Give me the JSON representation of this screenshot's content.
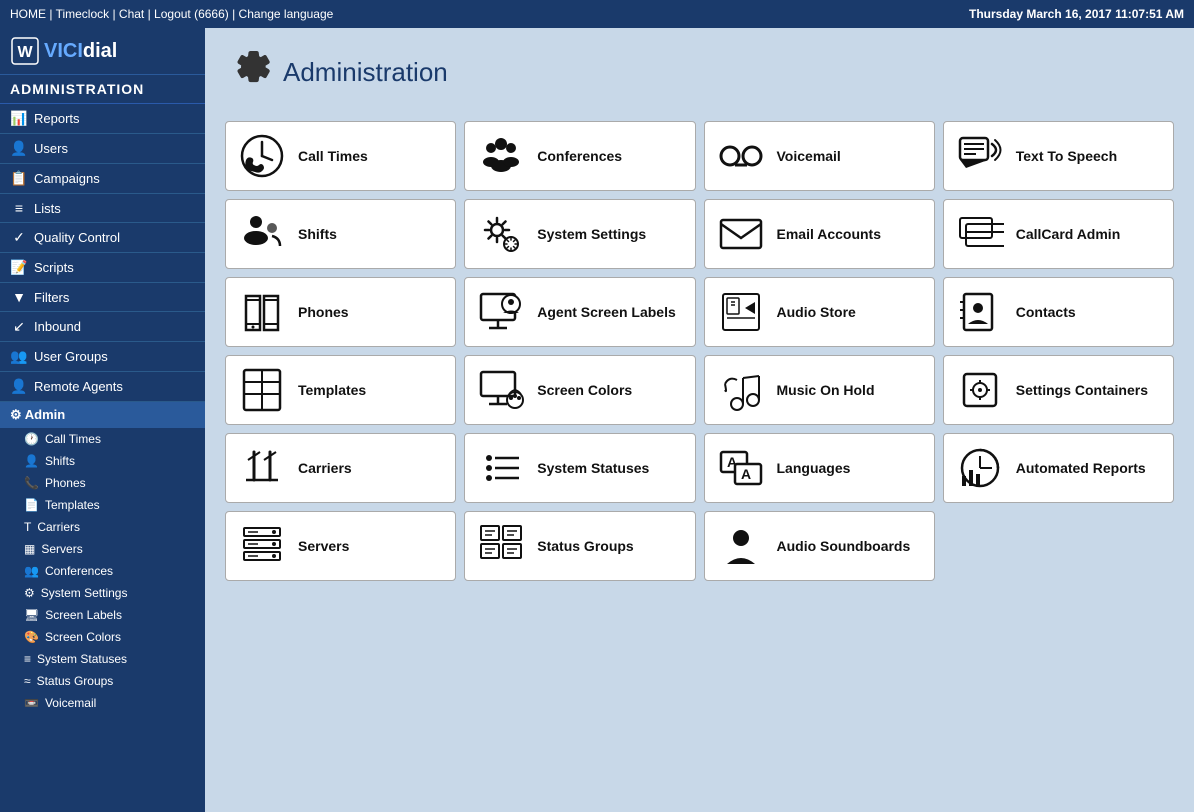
{
  "topbar": {
    "links": "HOME | Timeclock | Chat | Logout (6666) | Change language",
    "datetime": "Thursday March 16, 2017  11:07:51 AM"
  },
  "sidebar": {
    "logo": "VICIdial",
    "admin_title": "ADMINISTRATION",
    "nav_items": [
      {
        "label": "Reports",
        "icon": "📊",
        "name": "reports"
      },
      {
        "label": "Users",
        "icon": "👤",
        "name": "users"
      },
      {
        "label": "Campaigns",
        "icon": "📋",
        "name": "campaigns"
      },
      {
        "label": "Lists",
        "icon": "≡",
        "name": "lists"
      },
      {
        "label": "Quality Control",
        "icon": "✓",
        "name": "quality-control"
      },
      {
        "label": "Scripts",
        "icon": "📝",
        "name": "scripts"
      },
      {
        "label": "Filters",
        "icon": "▼",
        "name": "filters"
      },
      {
        "label": "Inbound",
        "icon": "↙",
        "name": "inbound"
      },
      {
        "label": "User Groups",
        "icon": "👥",
        "name": "user-groups"
      },
      {
        "label": "Remote Agents",
        "icon": "👤",
        "name": "remote-agents"
      }
    ],
    "admin_section": "Admin",
    "admin_subitems": [
      {
        "label": "Call Times",
        "icon": "🕐",
        "name": "call-times"
      },
      {
        "label": "Shifts",
        "icon": "👤",
        "name": "shifts"
      },
      {
        "label": "Phones",
        "icon": "📞",
        "name": "phones"
      },
      {
        "label": "Templates",
        "icon": "📄",
        "name": "templates"
      },
      {
        "label": "Carriers",
        "icon": "T",
        "name": "carriers"
      },
      {
        "label": "Servers",
        "icon": "▦",
        "name": "servers"
      },
      {
        "label": "Conferences",
        "icon": "👥",
        "name": "conferences"
      },
      {
        "label": "System Settings",
        "icon": "⚙",
        "name": "system-settings"
      },
      {
        "label": "Screen Labels",
        "icon": "🖥",
        "name": "screen-labels"
      },
      {
        "label": "Screen Colors",
        "icon": "🎨",
        "name": "screen-colors"
      },
      {
        "label": "System Statuses",
        "icon": "≡",
        "name": "system-statuses"
      },
      {
        "label": "Status Groups",
        "icon": "≈",
        "name": "status-groups"
      },
      {
        "label": "Voicemail",
        "icon": "📼",
        "name": "voicemail"
      }
    ]
  },
  "main": {
    "title": "Administration",
    "cards": [
      {
        "id": "call-times",
        "label": "Call Times"
      },
      {
        "id": "conferences",
        "label": "Conferences"
      },
      {
        "id": "voicemail",
        "label": "Voicemail"
      },
      {
        "id": "text-to-speech",
        "label": "Text To Speech"
      },
      {
        "id": "shifts",
        "label": "Shifts"
      },
      {
        "id": "system-settings",
        "label": "System Settings"
      },
      {
        "id": "email-accounts",
        "label": "Email Accounts"
      },
      {
        "id": "callcard-admin",
        "label": "CallCard Admin"
      },
      {
        "id": "phones",
        "label": "Phones"
      },
      {
        "id": "agent-screen-labels",
        "label": "Agent Screen Labels"
      },
      {
        "id": "audio-store",
        "label": "Audio Store"
      },
      {
        "id": "contacts",
        "label": "Contacts"
      },
      {
        "id": "templates",
        "label": "Templates"
      },
      {
        "id": "screen-colors",
        "label": "Screen Colors"
      },
      {
        "id": "music-on-hold",
        "label": "Music On Hold"
      },
      {
        "id": "settings-containers",
        "label": "Settings Containers"
      },
      {
        "id": "carriers",
        "label": "Carriers"
      },
      {
        "id": "system-statuses",
        "label": "System Statuses"
      },
      {
        "id": "languages",
        "label": "Languages"
      },
      {
        "id": "automated-reports",
        "label": "Automated Reports"
      },
      {
        "id": "servers",
        "label": "Servers"
      },
      {
        "id": "status-groups",
        "label": "Status Groups"
      },
      {
        "id": "audio-soundboards",
        "label": "Audio Soundboards"
      }
    ]
  }
}
